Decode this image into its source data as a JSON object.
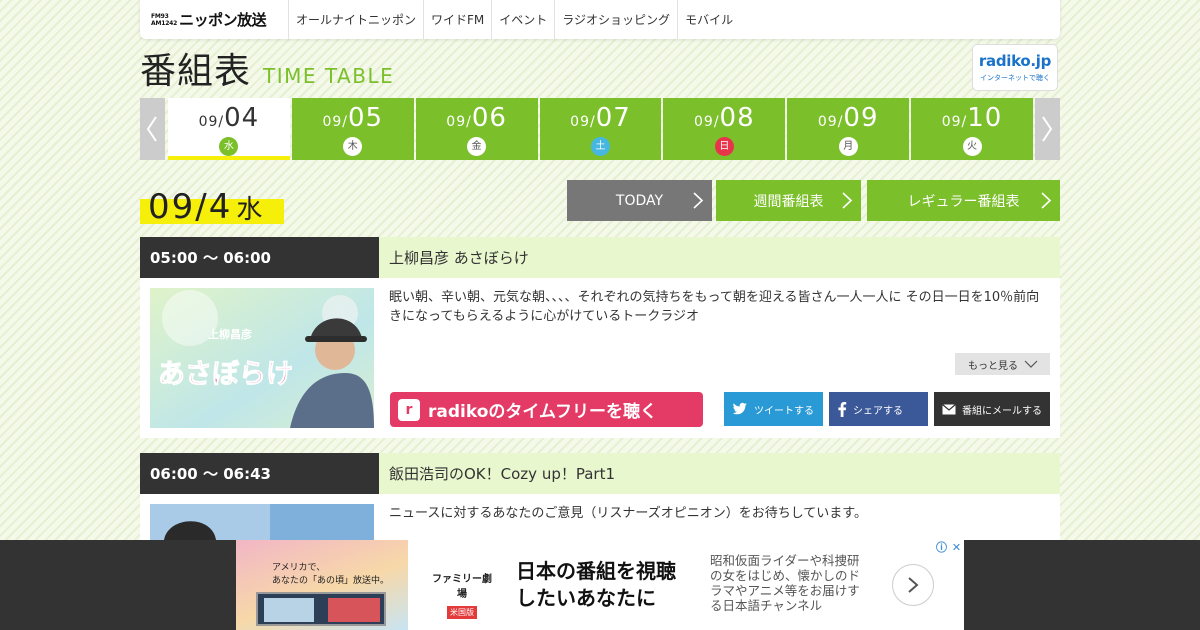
{
  "header": {
    "logo_fm": "FM93",
    "logo_am": "AM1242",
    "logo_name": "ニッポン放送",
    "nav": [
      "オールナイトニッポン",
      "ワイドFM",
      "イベント",
      "ラジオショッピング",
      "モバイル"
    ]
  },
  "page": {
    "title_jp": "番組表",
    "title_en": "TIME TABLE",
    "radiko_logo": "radiko.jp",
    "radiko_sub": "インターネットで聴く"
  },
  "date_tabs": [
    {
      "month": "09/",
      "day": "04",
      "weekday": "水",
      "active": true
    },
    {
      "month": "09/",
      "day": "05",
      "weekday": "木"
    },
    {
      "month": "09/",
      "day": "06",
      "weekday": "金"
    },
    {
      "month": "09/",
      "day": "07",
      "weekday": "土"
    },
    {
      "month": "09/",
      "day": "08",
      "weekday": "日"
    },
    {
      "month": "09/",
      "day": "09",
      "weekday": "月"
    },
    {
      "month": "09/",
      "day": "10",
      "weekday": "火"
    }
  ],
  "current": {
    "date": "09/4",
    "weekday": "水"
  },
  "buttons": {
    "today": "TODAY",
    "weekly": "週間番組表",
    "regular": "レギュラー番組表"
  },
  "programs": [
    {
      "time": "05:00 ～ 06:00",
      "title": "上柳昌彦 あさぼらけ",
      "description": "眠い朝、辛い朝、元気な朝、、、、それぞれの気持ちをもって朝を迎える皆さん一人一人に その日一日を10％前向きになってもらえるように心がけているトークラジオ",
      "thumb_text": "あさぼらけ",
      "thumb_small": "上柳昌彦",
      "more": "もっと見る",
      "radiko": "radikoのタイムフリーを聴く",
      "tweet": "ツイートする",
      "share": "シェアする",
      "mail": "番組にメールする"
    },
    {
      "time": "06:00 ～ 06:43",
      "title": "飯田浩司のOK！Cozy up！Part1",
      "description": "ニュースに対するあなたのご意見（リスナーズオピニオン）をお待ちしています。"
    }
  ],
  "ad": {
    "image_caption_1": "アメリカで、",
    "image_caption_2": "あなたの「あの頃」放送中。",
    "brand_1": "ファミリー劇場",
    "brand_2": "米国版",
    "headline_1": "日本の番組を視聴",
    "headline_2": "したいあなたに",
    "sub": "昭和仮面ライダーや科捜研の女をはじめ、懐かしのドラマやアニメ等をお届けする日本語チャンネル"
  }
}
